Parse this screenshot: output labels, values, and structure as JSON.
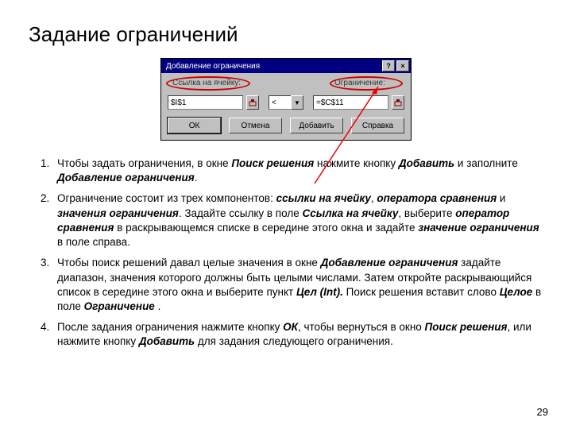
{
  "title": "Задание ограничений",
  "dialog": {
    "titlebar": "Добавление ограничения",
    "help": "?",
    "close": "×",
    "label_left": "Ссылка на ячейку:",
    "label_right": "Ограничение:",
    "input_cell": "$I$1",
    "operator": "<",
    "input_constraint": "=$C$11",
    "btn_ok": "ОК",
    "btn_cancel": "Отмена",
    "btn_add": "Добавить",
    "btn_help": "Справка"
  },
  "items": {
    "1": {
      "a": "Чтобы задать ограничения, в окне ",
      "b": "Поиск решения",
      "c": " нажмите кнопку ",
      "d": "Добавить",
      "e": " и заполните ",
      "f": "Добавление ограничения",
      "g": "."
    },
    "2": {
      "a": "Ограничение состоит из трех компонентов: ",
      "b": "ссылки на ячейку",
      "c": ", ",
      "d": "оператора сравнения",
      "e": " и ",
      "f": "значения ограничения",
      "g": ". Задайте ссылку в поле ",
      "h": "Ссылка на ячейку",
      "i": ", выберите ",
      "j": "оператор сравнения",
      "k": " в раскрывающемся списке в середине этого окна и задайте ",
      "l": "значение ограничения",
      "m": " в поле справа."
    },
    "3": {
      "a": "Чтобы поиск решений давал целые значения в окне ",
      "b": "Добавление ограничения",
      "c": " задайте диапазон, значения которого должны быть целыми числами. Затем откройте раскрывающийся список в середине этого окна и выберите пункт ",
      "d": "Цел (Int).",
      "e": " Поиск решения вставит слово ",
      "f": "Целое",
      "g": " в поле ",
      "h": "Ограничение",
      "i": " ."
    },
    "4": {
      "a": "После задания ограничения нажмите кнопку ",
      "b": "ОК",
      "c": ", чтобы вернуться в окно ",
      "d": "Поиск решения",
      "e": ", или нажмите кнопку ",
      "f": "Добавить",
      "g": " для задания следующего ограничения."
    }
  },
  "page": "29"
}
